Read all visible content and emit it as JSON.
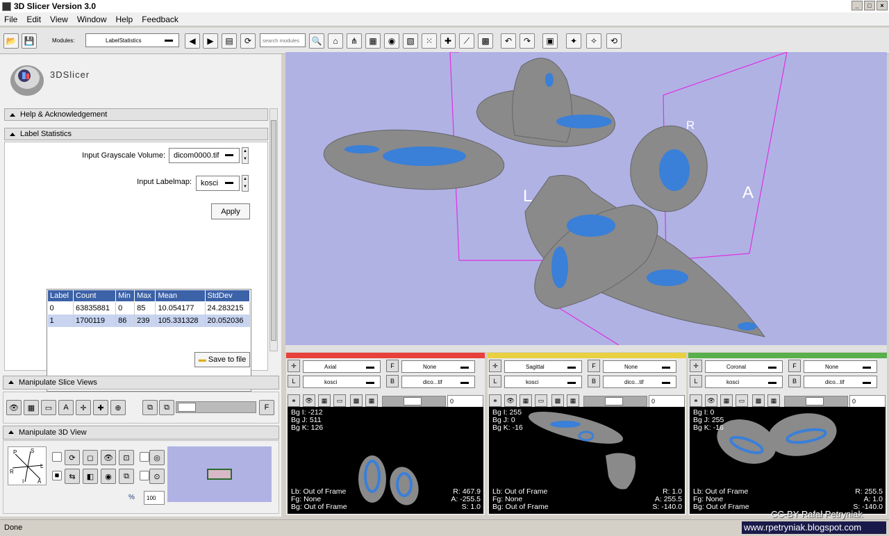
{
  "window": {
    "title": "3D Slicer Version 3.0",
    "min": "_",
    "max": "□",
    "close": "×"
  },
  "menu": [
    "File",
    "Edit",
    "View",
    "Window",
    "Help",
    "Feedback"
  ],
  "toolbar": {
    "modules_label": "Modules:",
    "module_selected": "LabelStatistics",
    "search_placeholder": "search modules"
  },
  "logo": {
    "text": "3DSlicer"
  },
  "sections": {
    "help": "Help & Acknowledgement",
    "label_stats": "Label Statistics",
    "slice_views": "Manipulate Slice Views",
    "view3d": "Manipulate 3D View"
  },
  "label_stats": {
    "grayscale_label": "Input Grayscale Volume:",
    "grayscale_value": "dicom0000.tif",
    "labelmap_label": "Input Labelmap:",
    "labelmap_value": "kosci",
    "apply": "Apply",
    "save": "Save to file",
    "columns": [
      "Label",
      "Count",
      "Min",
      "Max",
      "Mean",
      "StdDev"
    ],
    "rows": [
      [
        "0",
        "63835881",
        "0",
        "85",
        "10.054177",
        "24.283215"
      ],
      [
        "1",
        "1700119",
        "86",
        "239",
        "105.331328",
        "20.052036"
      ]
    ]
  },
  "view3d": {
    "labels": {
      "r": "R",
      "l": "L",
      "a": "A"
    },
    "zoom": "100",
    "orient": {
      "p": "P",
      "s": "S",
      "l": "L",
      "r": "R",
      "i": "I",
      "a": "A"
    }
  },
  "slices": [
    {
      "name": "Axial",
      "color": "#e8403a",
      "fg": "None",
      "label": "kosci",
      "bg": "dico...tif",
      "value": "0",
      "tl": [
        "Bg I: -212",
        "Bg J: 511",
        "Bg K: 126"
      ],
      "bl": [
        "Lb: Out of Frame",
        "Fg: None",
        "Bg: Out of Frame"
      ],
      "br": [
        "R: 467.9",
        "A: -255.5",
        "S: 1.0"
      ]
    },
    {
      "name": "Sagittal",
      "color": "#e8d040",
      "fg": "None",
      "label": "kosci",
      "bg": "dico...tif",
      "value": "0",
      "tl": [
        "Bg I: 255",
        "Bg J: 0",
        "Bg K: -16"
      ],
      "bl": [
        "Lb: Out of Frame",
        "Fg: None",
        "Bg: Out of Frame"
      ],
      "br": [
        "R: 1.0",
        "A: 255.5",
        "S: -140.0"
      ]
    },
    {
      "name": "Coronal",
      "color": "#58b04a",
      "fg": "None",
      "label": "kosci",
      "bg": "dico...tif",
      "value": "0",
      "tl": [
        "Bg I: 0",
        "Bg J: 255",
        "Bg K: -16"
      ],
      "bl": [
        "Lb: Out of Frame",
        "Fg: None",
        "Bg: Out of Frame"
      ],
      "br": [
        "R: 255.5",
        "A: 1.0",
        "S: -140.0"
      ]
    }
  ],
  "status": "Done",
  "watermark": {
    "line1": "CC-BY Rafał Petryniak",
    "line2": "www.rpetryniak.blogspot.com"
  },
  "colors": {
    "panel": "#f0f0f0",
    "view3d_bg": "#b0b2e4",
    "table_header": "#3c62a8",
    "bbox": "#e030e0",
    "label_blue": "#3a7fd8"
  }
}
